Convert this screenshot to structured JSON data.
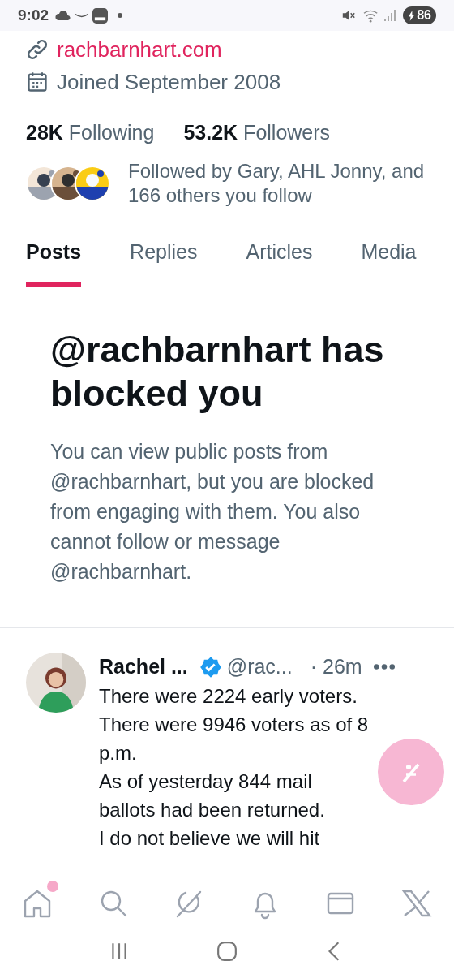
{
  "status_bar": {
    "time": "9:02",
    "battery": "86"
  },
  "profile": {
    "website": "rachbarnhart.com",
    "joined": "Joined September 2008"
  },
  "stats": [
    {
      "count": "28K",
      "label": "Following"
    },
    {
      "count": "53.2K",
      "label": "Followers"
    }
  ],
  "followed_by": {
    "text": "Followed by Gary, AHL Jonny, and 166 others you follow"
  },
  "tabs": [
    {
      "label": "Posts",
      "selected": true
    },
    {
      "label": "Replies",
      "selected": false
    },
    {
      "label": "Articles",
      "selected": false
    },
    {
      "label": "Media",
      "selected": false
    }
  ],
  "blocked": {
    "title": "@rachbarnhart has blocked you",
    "body": "You can view public posts from @rachbarnhart, but you are blocked from engaging with them. You also cannot follow or message @rachbarnhart."
  },
  "tweet": {
    "name": "Rachel ...",
    "verified": true,
    "handle": "@rac...",
    "time": "· 26m",
    "lines": [
      "There were 2224 early voters.",
      "There were 9946 voters as of 8 p.m.",
      "As of yesterday 844 mail ballots had been returned.",
      "I do not believe we will hit"
    ]
  },
  "nav": [
    {
      "kind": "home",
      "dot": true
    },
    {
      "kind": "search",
      "dot": false
    },
    {
      "kind": "grok",
      "dot": false
    },
    {
      "kind": "bell",
      "dot": false
    },
    {
      "kind": "mail",
      "dot": false
    },
    {
      "kind": "x",
      "dot": false
    }
  ]
}
